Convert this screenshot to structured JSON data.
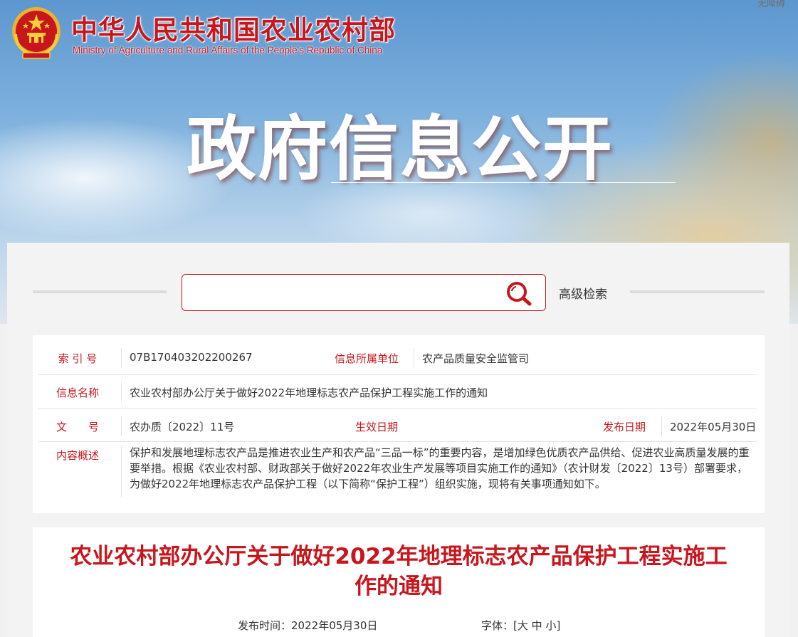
{
  "header": {
    "top_link": "无障碍",
    "site_name_cn": "中华人民共和国农业农村部",
    "site_name_en": "Ministry of Agriculture and Rural Affairs of the People's Republic of China",
    "banner_title": "政府信息公开"
  },
  "search": {
    "placeholder": "",
    "advanced_label": "高级检索"
  },
  "meta": {
    "index_label": "索 引 号",
    "index_value": "07B170403202200267",
    "unit_label": "信息所属单位",
    "unit_value": "农产品质量安全监管司",
    "name_label": "信息名称",
    "name_value": "农业农村部办公厅关于做好2022年地理标志农产品保护工程实施工作的通知",
    "doc_label": "文　　号",
    "doc_value": "农办质〔2022〕11号",
    "effective_label": "生效日期",
    "effective_value": "",
    "publish_label": "发布日期",
    "publish_value": "2022年05月30日",
    "summary_label": "内容概述",
    "summary_value": "保护和发展地理标志农产品是推进农业生产和农产品“三品一标”的重要内容，是增加绿色优质农产品供给、促进农业高质量发展的重要举措。根据《农业农村部、财政部关于做好2022年农业生产发展等项目实施工作的通知》（农计财发〔2022〕13号）部署要求，为做好2022年地理标志农产品保护工程（以下简称“保护工程”）组织实施，现将有关事项通知如下。"
  },
  "article": {
    "title": "农业农村部办公厅关于做好2022年地理标志农产品保护工程实施工作的通知",
    "pub_time_label": "发布时间：",
    "pub_time_value": "2022年05月30日",
    "font_label": "字体：",
    "font_open": "[",
    "font_large": "大",
    "font_medium": "中",
    "font_small": "小",
    "font_close": "]"
  },
  "colors": {
    "accent": "#c8161d",
    "text": "#333333",
    "panel": "#f3f3f3"
  },
  "icons": {
    "emblem": "national-emblem-icon",
    "search": "search-icon"
  }
}
